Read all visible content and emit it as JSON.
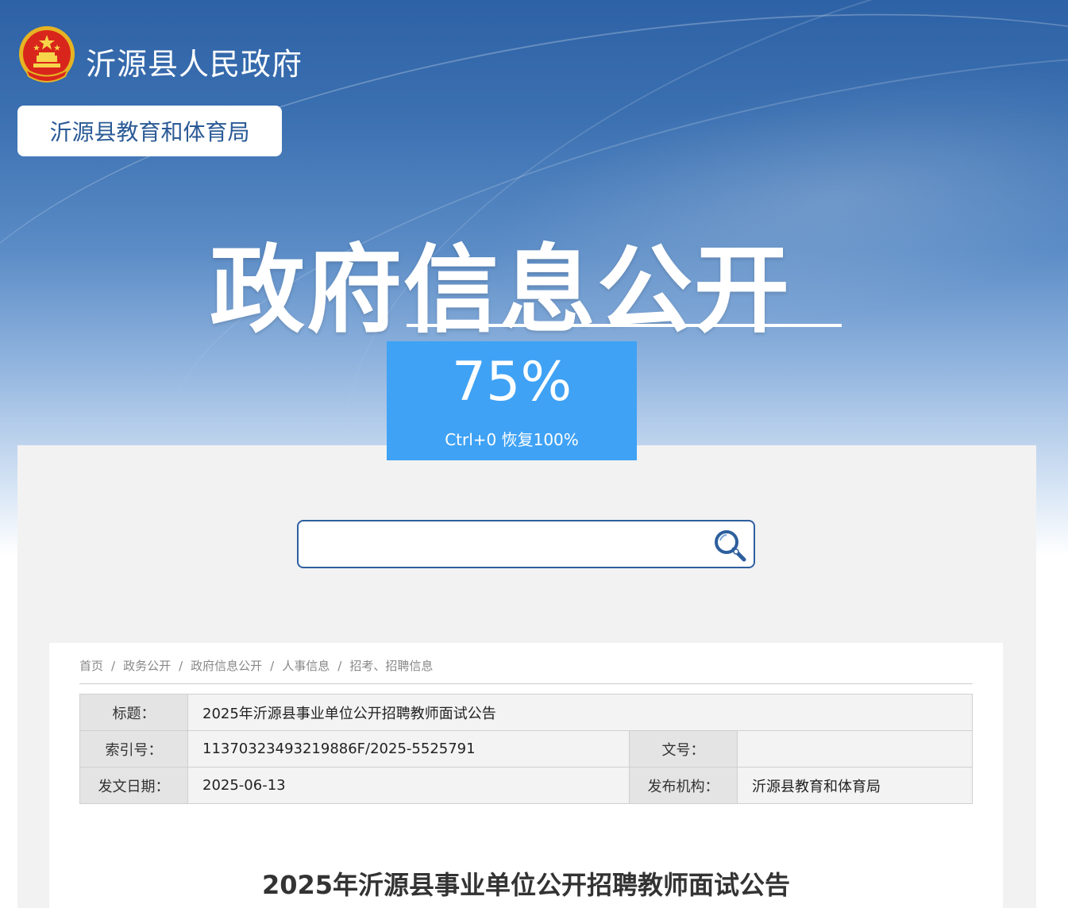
{
  "header": {
    "site_name": "沂源县人民政府",
    "department": "沂源县教育和体育局",
    "hero_title": "政府信息公开"
  },
  "zoom": {
    "level": "75%",
    "hint": "Ctrl+0 恢复100%"
  },
  "search": {
    "value": "",
    "placeholder": ""
  },
  "breadcrumb": [
    "首页",
    "政务公开",
    "政府信息公开",
    "人事信息",
    "招考、招聘信息"
  ],
  "meta": {
    "title_label": "标题：",
    "title_value": "2025年沂源县事业单位公开招聘教师面试公告",
    "index_label": "索引号：",
    "index_value": "11370323493219886F/2025-5525791",
    "docno_label": "文号：",
    "docno_value": "",
    "date_label": "发文日期：",
    "date_value": "2025-06-13",
    "org_label": "发布机构：",
    "org_value": "沂源县教育和体育局"
  },
  "article": {
    "title": "2025年沂源县事业单位公开招聘教师面试公告"
  },
  "colors": {
    "banner_blue": "#2e62a6",
    "zoom_blue": "#3fa2f5",
    "dept_text": "#2a5a96"
  },
  "icons": {
    "emblem": "national-emblem-icon",
    "search": "search-icon"
  }
}
